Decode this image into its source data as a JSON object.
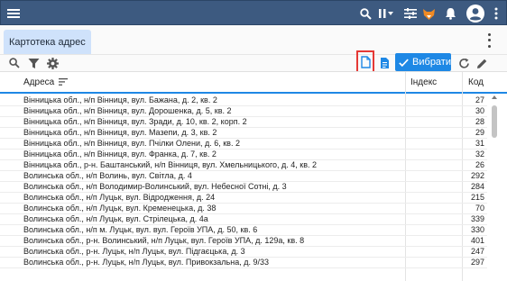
{
  "window": {
    "tab_label": "Картотека адрес"
  },
  "toolbar": {
    "pick_label": "Вибрати"
  },
  "table": {
    "columns": [
      "Адреса",
      "Індекс",
      "Код"
    ],
    "rows": [
      {
        "address": "Вінницька обл., н/п Вінниця, вул. Бажана, д. 2, кв. 2",
        "index": "",
        "code": "27"
      },
      {
        "address": "Вінницька обл., н/п Вінниця, вул. Дорошенка, д. 5, кв. 2",
        "index": "",
        "code": "30"
      },
      {
        "address": "Вінницька обл., н/п Вінниця, вул. Зради, д. 10, кв. 2, корп. 2",
        "index": "",
        "code": "28"
      },
      {
        "address": "Вінницька обл., н/п Вінниця, вул. Мазепи, д. 3, кв. 2",
        "index": "",
        "code": "29"
      },
      {
        "address": "Вінницька обл., н/п Вінниця, вул. Пчілки Олени, д. 6, кв. 2",
        "index": "",
        "code": "31"
      },
      {
        "address": "Вінницька обл., н/п Вінниця, вул. Франка, д. 7, кв. 2",
        "index": "",
        "code": "32"
      },
      {
        "address": "Вінницька обл., р-н. Баштанський, н/п Вінниця, вул. Хмельницького, д. 4, кв. 2",
        "index": "",
        "code": "26"
      },
      {
        "address": "Волинська обл., н/п Волинь, вул. Світла, д. 4",
        "index": "",
        "code": "292"
      },
      {
        "address": "Волинська обл., н/п Володимир-Волинський, вул. Небесної Сотні, д. 3",
        "index": "",
        "code": "284"
      },
      {
        "address": "Волинська обл., н/п Луцьк, вул. Відродження, д. 24",
        "index": "",
        "code": "215"
      },
      {
        "address": "Волинська обл., н/п Луцьк, вул. Кременецька, д. 38",
        "index": "",
        "code": "70"
      },
      {
        "address": "Волинська обл., н/п Луцьк, вул. Стрілецька, д. 4а",
        "index": "",
        "code": "339"
      },
      {
        "address": "Волинська обл., н/п м. Луцьк, вул. вул. Героїв УПА, д. 50, кв. 6",
        "index": "",
        "code": "330"
      },
      {
        "address": "Волинська обл., р-н. Волинський, н/п Луцьк, вул. Героїв УПА, д. 129а, кв. 8",
        "index": "",
        "code": "401"
      },
      {
        "address": "Волинська обл., р-н. Луцьк, н/п Луцьк, вул. Підгаєцька, д. 3",
        "index": "",
        "code": "247"
      },
      {
        "address": "Волинська обл., р-н. Луцьк, н/п Луцьк, вул. Привокзальна, д. 9/33",
        "index": "",
        "code": "297"
      }
    ]
  },
  "colors": {
    "header": "#3d5a80",
    "accent": "#1e88e5",
    "tab_bg": "#cfe2fb",
    "highlight": "#e53935"
  }
}
